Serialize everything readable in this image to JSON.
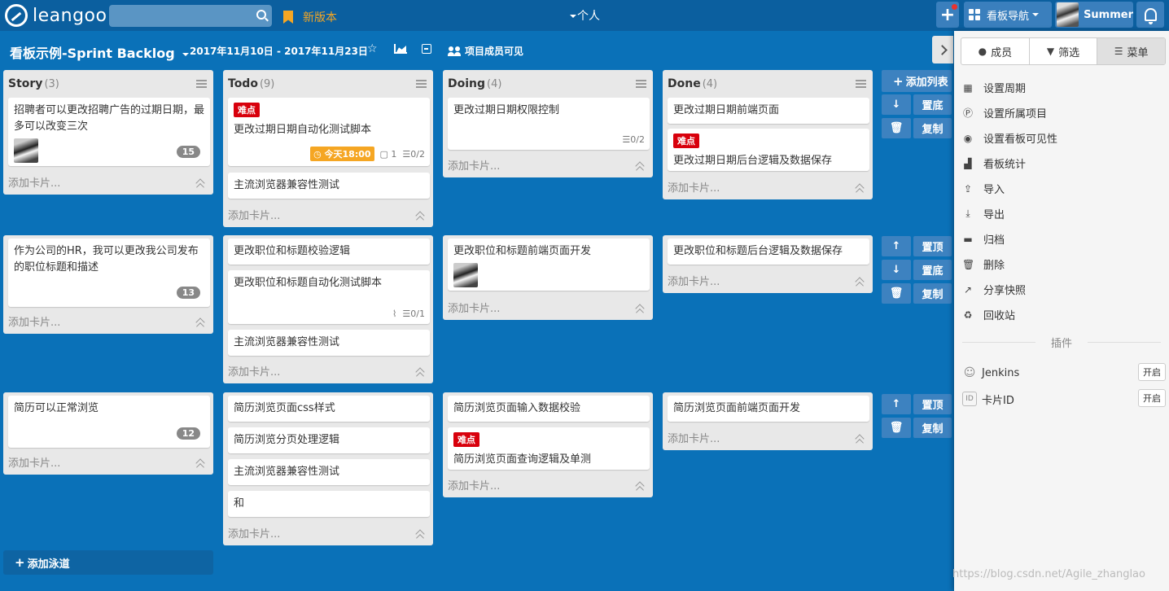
{
  "topbar": {
    "logo_text": "leangoo",
    "search": {
      "placeholder": "",
      "value": ""
    },
    "new_version": "新版本",
    "personal": "个人",
    "board_nav": "看板导航",
    "user_name": "Summer"
  },
  "board": {
    "title": "看板示例-Sprint Backlog",
    "dates": "2017年11月10日 - 2017年11月23日",
    "visibility": "项目成员可见"
  },
  "lists": [
    {
      "name": "Story",
      "count": "(3)"
    },
    {
      "name": "Todo",
      "count": "(9)"
    },
    {
      "name": "Doing",
      "count": "(4)"
    },
    {
      "name": "Done",
      "count": "(4)"
    }
  ],
  "labels": {
    "hard": "难点",
    "add_card": "添加卡片...",
    "add_list": "添加列表",
    "add_lane": "添加泳道",
    "move_top": "置顶",
    "move_bottom": "置底",
    "copy": "复制"
  },
  "lanes": [
    {
      "story": {
        "text": "招聘者可以更改招聘广告的过期日期，最多可以改变三次",
        "points": "15"
      },
      "todo": [
        {
          "label": "难点",
          "text": "更改过期日期自动化测试脚本",
          "due": "今天18:00",
          "comments": "1",
          "checklist": "0/2"
        },
        {
          "text": "主流浏览器兼容性测试"
        }
      ],
      "doing": [
        {
          "text": "更改过期日期权限控制",
          "checklist": "0/2"
        }
      ],
      "done": [
        {
          "text": "更改过期日期前端页面"
        },
        {
          "label": "难点",
          "text": "更改过期日期后台逻辑及数据保存"
        }
      ]
    },
    {
      "story": {
        "text": "作为公司的HR，我可以更改我公司发布的职位标题和描述",
        "points": "13"
      },
      "todo": [
        {
          "text": "更改职位和标题校验逻辑"
        },
        {
          "text": "更改职位和标题自动化测试脚本",
          "checklist": "0/1"
        },
        {
          "text": "主流浏览器兼容性测试"
        }
      ],
      "doing": [
        {
          "text": "更改职位和标题前端页面开发"
        }
      ],
      "done": [
        {
          "text": "更改职位和标题后台逻辑及数据保存"
        }
      ]
    },
    {
      "story": {
        "text": "简历可以正常浏览",
        "points": "12"
      },
      "todo": [
        {
          "text": "简历浏览页面css样式"
        },
        {
          "text": "简历浏览分页处理逻辑"
        },
        {
          "text": "主流浏览器兼容性测试"
        },
        {
          "text": "和"
        }
      ],
      "doing": [
        {
          "text": "简历浏览页面输入数据校验"
        },
        {
          "label": "难点",
          "text": "简历浏览页面查询逻辑及单测"
        }
      ],
      "done": [
        {
          "text": "简历浏览页面前端页面开发"
        }
      ]
    }
  ],
  "side_panel": {
    "tabs": [
      "成员",
      "筛选",
      "菜单"
    ],
    "menu": [
      "设置周期",
      "设置所属项目",
      "设置看板可见性",
      "看板统计",
      "导入",
      "导出",
      "归档",
      "删除",
      "分享快照",
      "回收站"
    ],
    "plugins_title": "插件",
    "plugins": [
      {
        "name": "Jenkins",
        "action": "开启"
      },
      {
        "name": "卡片ID",
        "action": "开启"
      }
    ]
  },
  "watermark": "https://blog.csdn.net/Agile_zhanglao",
  "colors": {
    "board_bg": "#0a71b8",
    "topbar_bg": "#0b5f9f",
    "hard_label": "#d8000c",
    "due_badge": "#f5a623"
  }
}
